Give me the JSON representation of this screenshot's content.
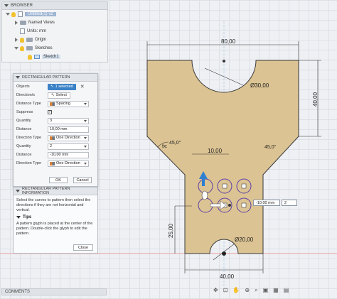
{
  "browser": {
    "title": "BROWSER",
    "document": "Untitled(1) v2",
    "items": [
      {
        "label": "Named Views"
      },
      {
        "label": "Units: mm"
      },
      {
        "label": "Origin"
      },
      {
        "label": "Sketches"
      },
      {
        "label": "Sketch1"
      }
    ]
  },
  "dialog": {
    "title": "RECTANGULAR PATTERN",
    "objects_label": "Objects",
    "objects_value": "1 selected",
    "directions_label": "Direction/s",
    "select_label": "Select",
    "distance_type_label": "Distance Type",
    "distance_type_value": "Spacing",
    "suppress_label": "Suppress",
    "quantity1_label": "Quantity",
    "quantity1_value": "3",
    "distance1_label": "Distance",
    "distance1_value": "10,00 mm",
    "direction_type1_label": "Direction Type",
    "direction_type1_value": "One Direction",
    "quantity2_label": "Quantity",
    "quantity2_value": "2",
    "distance2_label": "Distance",
    "distance2_value": "-10,00 mm",
    "direction_type2_label": "Direction Type",
    "direction_type2_value": "One Direction",
    "ok_label": "OK",
    "cancel_label": "Cancel"
  },
  "info": {
    "title": "RECTANGULAR PATTERN INFORMATION",
    "text1": "Select the curves to pattern then select the directions if they are not horizontal and vertical.",
    "tips_label": "Tips",
    "text2": "A pattern glyph is placed at the center of the pattern. Double-click the glyph to edit the pattern.",
    "close_label": "Close"
  },
  "comments": {
    "title": "COMMENTS"
  },
  "canvas": {
    "dims": {
      "top_width": "80,00",
      "right_height": "40,00",
      "top_arc": "Ø30,00",
      "chamfer_left": "45,0°",
      "chamfer_right": "45,0°",
      "spacing": "10,00",
      "left_height": "25,00",
      "bottom_arc": "Ø20,00",
      "bottom_width": "40,00",
      "angle_left_prefix": "fx:"
    },
    "pattern_input_distance": "-10,00 mm",
    "pattern_input_quantity": "2"
  },
  "colors": {
    "sketch_fill": "#dcc393",
    "sketch_line": "#3a3a3a",
    "accent": "#3b82c7",
    "origin_line": "#d9534f"
  }
}
